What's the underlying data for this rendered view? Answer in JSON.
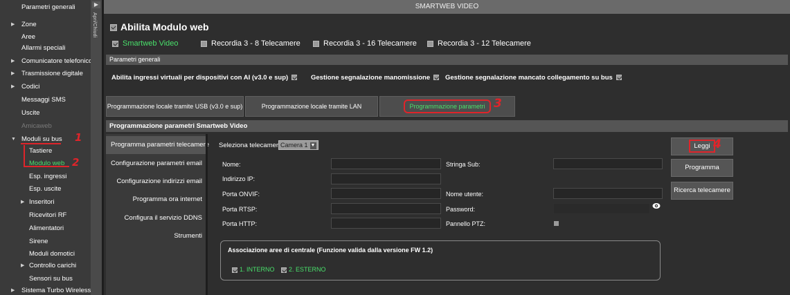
{
  "sidebar": {
    "items": [
      {
        "label": "Parametri generali",
        "indent": 0,
        "arrow": false
      },
      {
        "label": "Zone",
        "indent": 0,
        "arrow": true
      },
      {
        "label": "Aree",
        "indent": 0,
        "arrow": false
      },
      {
        "label": "Allarmi speciali",
        "indent": 0,
        "arrow": false
      },
      {
        "label": "Comunicatore telefonico",
        "indent": 0,
        "arrow": true
      },
      {
        "label": "Trasmissione digitale",
        "indent": 0,
        "arrow": true
      },
      {
        "label": "Codici",
        "indent": 0,
        "arrow": true
      },
      {
        "label": "Messaggi SMS",
        "indent": 0,
        "arrow": false
      },
      {
        "label": "Uscite",
        "indent": 0,
        "arrow": false
      },
      {
        "label": "Amicaweb",
        "indent": 0,
        "arrow": false,
        "disabled": true
      },
      {
        "label": "Moduli su bus",
        "indent": 0,
        "arrow": true,
        "expanded": true
      },
      {
        "label": "Tastiere",
        "indent": 1,
        "arrow": false
      },
      {
        "label": "Modulo web",
        "indent": 1,
        "arrow": false,
        "active": true
      },
      {
        "label": "Esp. ingressi",
        "indent": 1,
        "arrow": false
      },
      {
        "label": "Esp. uscite",
        "indent": 1,
        "arrow": false
      },
      {
        "label": "Inseritori",
        "indent": 1,
        "arrow": true
      },
      {
        "label": "Ricevitori RF",
        "indent": 1,
        "arrow": false
      },
      {
        "label": "Alimentatori",
        "indent": 1,
        "arrow": false
      },
      {
        "label": "Sirene",
        "indent": 1,
        "arrow": false
      },
      {
        "label": "Moduli domotici",
        "indent": 1,
        "arrow": false
      },
      {
        "label": "Controllo carichi",
        "indent": 1,
        "arrow": true
      },
      {
        "label": "Sensori su bus",
        "indent": 1,
        "arrow": false
      },
      {
        "label": "Sistema Turbo Wireless",
        "indent": 0,
        "arrow": true
      }
    ],
    "collapse_tab_label": "Apri/Chiudi"
  },
  "header": {
    "title": "SMARTWEB VIDEO"
  },
  "enable": {
    "label": "Abilita Modulo web",
    "checked": true
  },
  "modules": [
    {
      "label": "Smartweb Video",
      "checked": true
    },
    {
      "label": "Recordia 3 - 8 Telecamere",
      "checked": false
    },
    {
      "label": "Recordia 3 - 16 Telecamere",
      "checked": false
    },
    {
      "label": "Recordia 3 - 12 Telecamere",
      "checked": false
    }
  ],
  "general": {
    "section_title": "Parametri generali",
    "options": [
      {
        "label": "Abilita ingressi virtuali per dispositivi con AI (v3.0 e sup)",
        "checked": true
      },
      {
        "label": "Gestione segnalazione manomissione",
        "checked": true
      },
      {
        "label": "Gestione segnalazione mancato collegamento su bus",
        "checked": true
      }
    ]
  },
  "tabs": [
    {
      "label": "Programmazione locale tramite USB (v3.0 e sup)"
    },
    {
      "label": "Programmazione locale tramite LAN"
    },
    {
      "label": "Programmazione parametri",
      "active": true
    }
  ],
  "smartweb_section": {
    "title": "Programmazione parametri Smartweb Video"
  },
  "left_menu": [
    {
      "label": "Programma parametri telecamere",
      "active": true
    },
    {
      "label": "Configurazione parametri email"
    },
    {
      "label": "Configurazione indirizzi email"
    },
    {
      "label": "Programma ora internet"
    },
    {
      "label": "Configura il servizio DDNS"
    },
    {
      "label": "Strumenti"
    }
  ],
  "camera": {
    "select_label": "Seleziona telecamera",
    "selected": "Camera 1"
  },
  "fields_left": [
    {
      "label": "Nome:",
      "value": ""
    },
    {
      "label": "Indirizzo IP:",
      "value": ""
    },
    {
      "label": "Porta ONVIF:",
      "value": ""
    },
    {
      "label": "Porta RTSP:",
      "value": ""
    },
    {
      "label": "Porta HTTP:",
      "value": ""
    }
  ],
  "fields_right": {
    "sub": {
      "label": "Stringa Sub:",
      "value": ""
    },
    "user": {
      "label": "Nome utente:",
      "value": ""
    },
    "password": {
      "label": "Password:",
      "value": ""
    },
    "ptz": {
      "label": "Pannello PTZ:",
      "checked": false
    }
  },
  "buttons": {
    "read": "Leggi",
    "program": "Programma",
    "search": "Ricerca telecamere"
  },
  "areas": {
    "title": "Associazione aree di centrale (Funzione valida dalla versione FW 1.2)",
    "items": [
      {
        "label": "1. INTERNO",
        "checked": true
      },
      {
        "label": "2. ESTERNO",
        "checked": true
      }
    ]
  },
  "annotations": {
    "n1": "1",
    "n2": "2",
    "n3": "3",
    "n4": "4"
  },
  "colors": {
    "accent_green": "#49e06b",
    "annotation_red": "#e0242a",
    "panel_dark": "#2e2e2e",
    "title_gray": "#6a6a6a"
  }
}
